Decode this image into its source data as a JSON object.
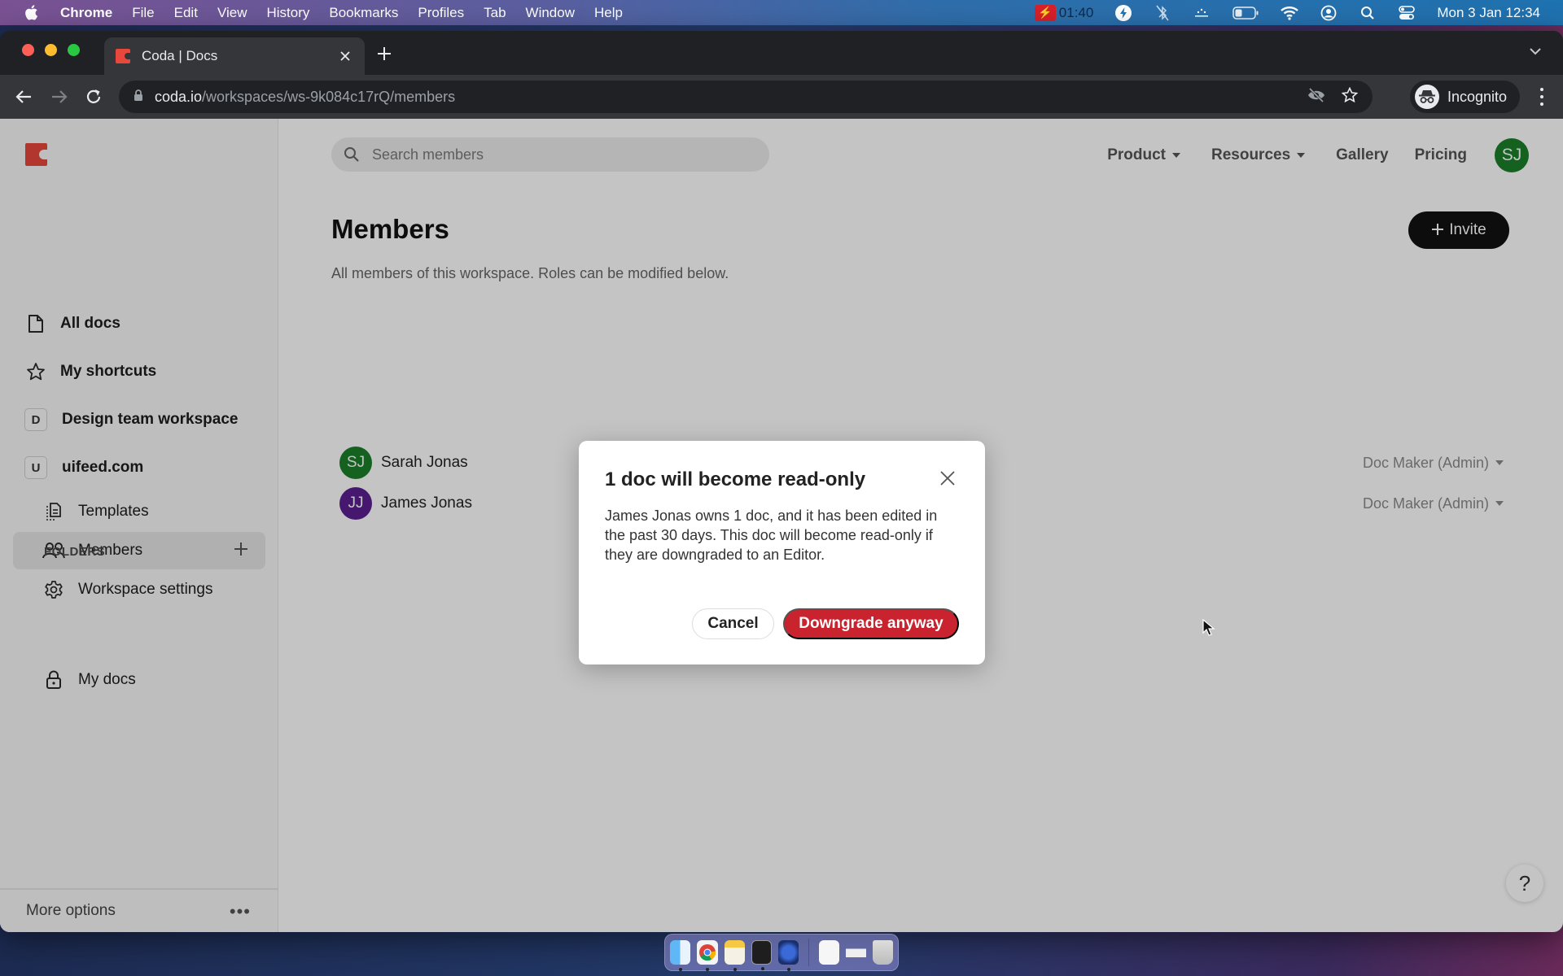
{
  "menubar": {
    "app_name": "Chrome",
    "menus": [
      "File",
      "Edit",
      "View",
      "History",
      "Bookmarks",
      "Profiles",
      "Tab",
      "Window",
      "Help"
    ],
    "recording_time": "01:40",
    "datetime": "Mon 3 Jan  12:34",
    "status_icons": [
      "recording-icon",
      "flash-icon",
      "bluetooth-off-icon",
      "wifi-extension-icon",
      "battery-icon",
      "wifi-icon",
      "user-icon",
      "spotlight-icon",
      "control-center-icon"
    ]
  },
  "browser": {
    "tab_title": "Coda | Docs",
    "url_host": "coda.io",
    "url_path": "/workspaces/ws-9k084c17rQ/members",
    "profile_label": "Incognito"
  },
  "sidebar": {
    "items": [
      {
        "label": "All docs",
        "icon": "document-icon"
      },
      {
        "label": "My shortcuts",
        "icon": "star-icon"
      },
      {
        "label": "Design team workspace",
        "badge": "D"
      },
      {
        "label": "uifeed.com",
        "badge": "U"
      },
      {
        "label": "Templates",
        "icon": "templates-icon"
      },
      {
        "label": "Members",
        "icon": "members-icon",
        "active": true
      },
      {
        "label": "Workspace settings",
        "icon": "gear-icon"
      }
    ],
    "folders_label": "FOLDERS",
    "folders": [
      {
        "label": "My docs",
        "icon": "lock-icon"
      }
    ],
    "footer_label": "More options"
  },
  "header": {
    "search_placeholder": "Search members",
    "nav": [
      {
        "label": "Product",
        "dropdown": true
      },
      {
        "label": "Resources",
        "dropdown": true
      },
      {
        "label": "Gallery",
        "dropdown": false
      },
      {
        "label": "Pricing",
        "dropdown": false
      }
    ],
    "user_initials": "SJ"
  },
  "main": {
    "title": "Members",
    "subtitle": "All members of this workspace. Roles can be modified below.",
    "invite_label": "Invite",
    "members": [
      {
        "initials": "SJ",
        "name": "Sarah Jonas",
        "role": "Doc Maker (Admin)",
        "color": "#1a7f2a"
      },
      {
        "initials": "JJ",
        "name": "James Jonas",
        "role": "Doc Maker (Admin)",
        "color": "#5b1f8f"
      }
    ],
    "help_label": "?"
  },
  "modal": {
    "title": "1 doc will become read-only",
    "body": "James Jonas owns 1 doc, and it has been edited in the past 30 days. This doc will become read-only if they are downgraded to an Editor.",
    "cancel_label": "Cancel",
    "confirm_label": "Downgrade anyway",
    "confirm_color": "#c8232e"
  },
  "dock": {
    "apps": [
      "Finder",
      "Chrome",
      "Notes",
      "Terminal",
      "Flashlight",
      "Document",
      "Screenshot",
      "Trash"
    ]
  }
}
